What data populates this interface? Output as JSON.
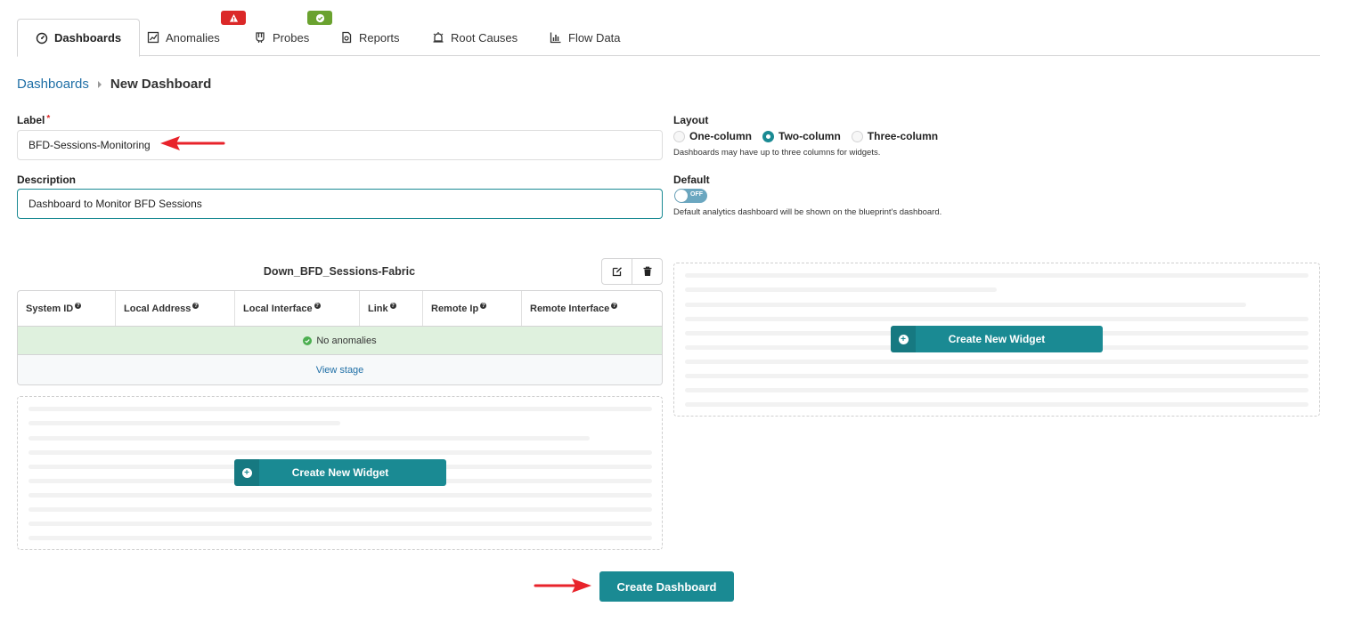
{
  "tabs": [
    {
      "label": "Dashboards",
      "icon": "gauge-icon",
      "active": true
    },
    {
      "label": "Anomalies",
      "icon": "chart-icon",
      "active": false
    },
    {
      "label": "Probes",
      "icon": "probe-icon",
      "active": false
    },
    {
      "label": "Reports",
      "icon": "report-icon",
      "active": false
    },
    {
      "label": "Root Causes",
      "icon": "alarm-icon",
      "active": false
    },
    {
      "label": "Flow Data",
      "icon": "bar-chart-icon",
      "active": false
    }
  ],
  "colors": {
    "accent": "#1a8a93",
    "link": "#1f6fa6",
    "danger": "#db2828",
    "success": "#6aa22f",
    "anomaly_ok_bg": "#dff1de"
  },
  "breadcrumb": {
    "parent": "Dashboards",
    "current": "New Dashboard"
  },
  "form": {
    "label": {
      "title": "Label",
      "required_mark": "*",
      "value": "BFD-Sessions-Monitoring"
    },
    "description": {
      "title": "Description",
      "value": "Dashboard to Monitor BFD Sessions"
    },
    "layout": {
      "title": "Layout",
      "options": [
        "One-column",
        "Two-column",
        "Three-column"
      ],
      "selected": "Two-column",
      "hint": "Dashboards may have up to three columns for widgets."
    },
    "default": {
      "title": "Default",
      "toggle_text": "OFF",
      "hint": "Default analytics dashboard will be shown on the blueprint's dashboard."
    }
  },
  "widget": {
    "title": "Down_BFD_Sessions-Fabric",
    "columns": [
      "System ID",
      "Local Address",
      "Local Interface",
      "Link",
      "Remote Ip",
      "Remote Interface"
    ],
    "status": "No anomalies",
    "view_stage": "View stage"
  },
  "create_widget_label": "Create New Widget",
  "create_dashboard_label": "Create Dashboard"
}
